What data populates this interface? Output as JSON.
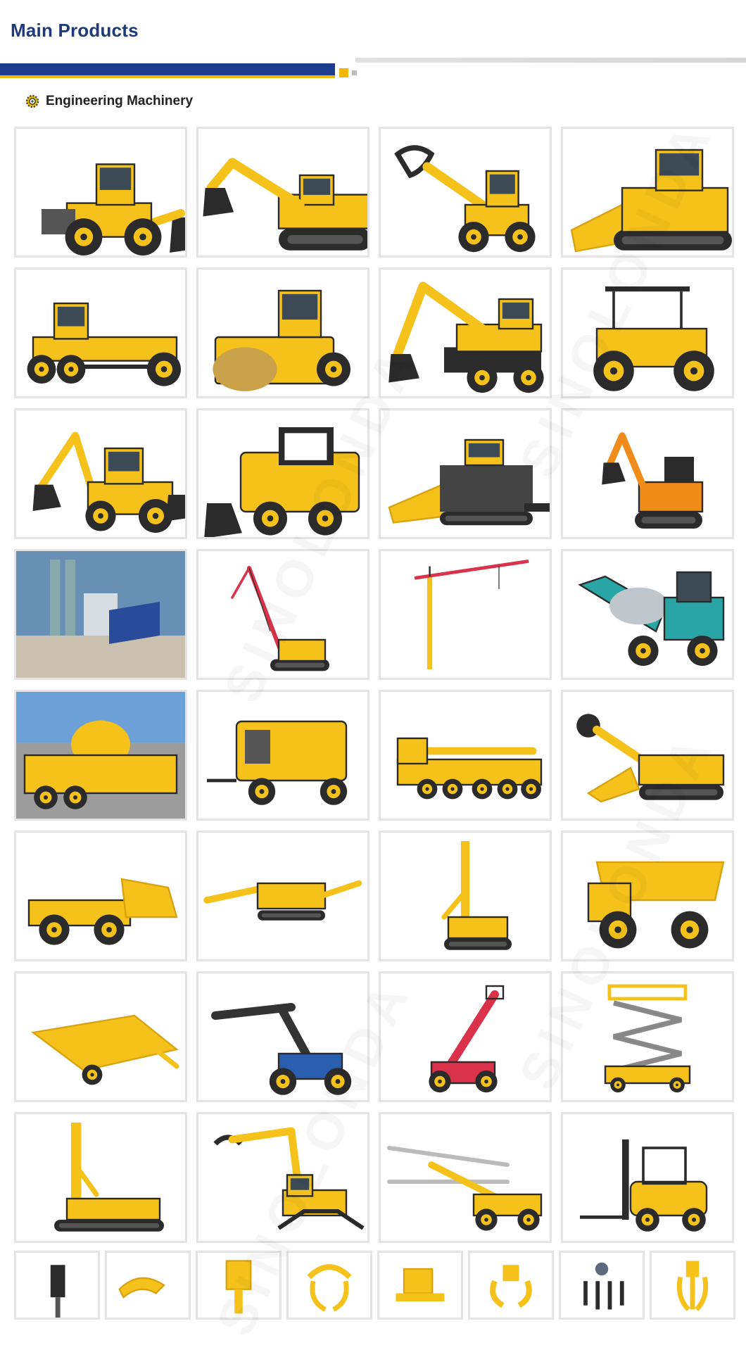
{
  "header": {
    "title": "Main Products"
  },
  "section": {
    "label": "Engineering Machinery",
    "icon": "gear-icon"
  },
  "colors": {
    "brand_blue": "#1c3d8e",
    "accent_yellow": "#f2b705",
    "card_border": "#e4e4e4",
    "machine_yellow": "#f4c21a"
  },
  "grid": {
    "rows": [
      [
        "wheel-loader",
        "crawler-excavator",
        "log-grapple-loader",
        "bulldozer"
      ],
      [
        "motor-grader",
        "road-roller",
        "wheel-excavator",
        "double-drum-roller"
      ],
      [
        "backhoe-loader",
        "skid-steer-loader",
        "asphalt-paver",
        "mini-excavator"
      ],
      [
        "concrete-batching-plant",
        "crawler-crane",
        "tower-crane",
        "self-loading-concrete-mixer"
      ],
      [
        "concrete-mixer-pump",
        "trailer-concrete-pump",
        "truck-crane",
        "roadheader"
      ],
      [
        "underground-loader",
        "mobile-crusher",
        "rotary-drilling-rig",
        "mining-dump-truck"
      ],
      [
        "mobile-screening-plant",
        "reach-stacker",
        "telescopic-handler",
        "scissor-lift"
      ],
      [
        "water-well-drilling-rig",
        "material-handler",
        "drilling-jumbo",
        "forklift"
      ]
    ],
    "attachments": [
      "hydraulic-breaker",
      "demolition-shear",
      "vibro-ripper",
      "log-grapple",
      "plate-compactor",
      "stone-grab",
      "rotating-grapple",
      "orange-peel-grab"
    ]
  },
  "watermark": "SINOLONDA"
}
